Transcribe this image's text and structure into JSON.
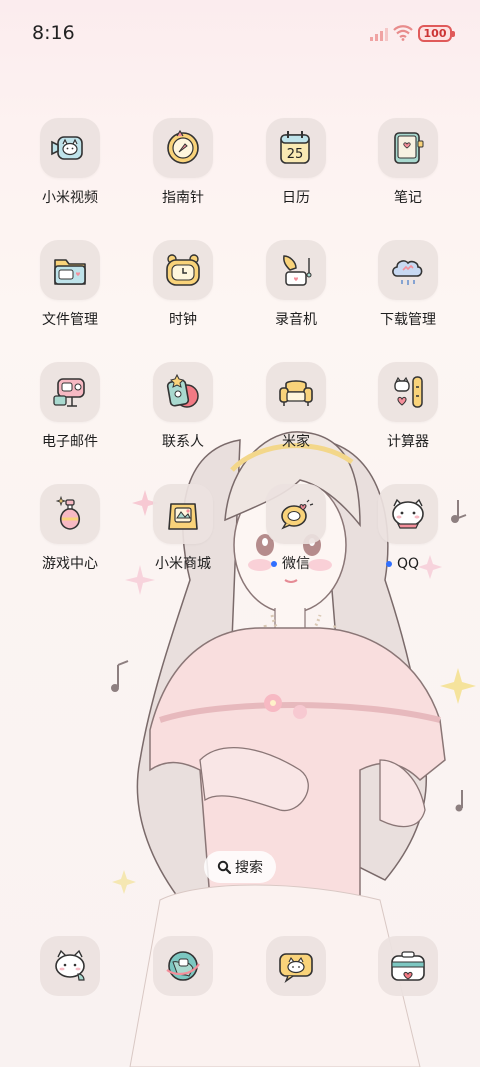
{
  "status_bar": {
    "time": "8:16",
    "battery": "100"
  },
  "apps": [
    {
      "label": "小米视频",
      "icon": "video-camera-cat-icon"
    },
    {
      "label": "指南针",
      "icon": "compass-icon"
    },
    {
      "label": "日历",
      "icon": "calendar-icon",
      "day": "25"
    },
    {
      "label": "笔记",
      "icon": "notebook-icon"
    },
    {
      "label": "文件管理",
      "icon": "folder-icon"
    },
    {
      "label": "时钟",
      "icon": "clock-icon"
    },
    {
      "label": "录音机",
      "icon": "gramophone-icon"
    },
    {
      "label": "下载管理",
      "icon": "cloud-download-icon"
    },
    {
      "label": "电子邮件",
      "icon": "mail-robot-icon"
    },
    {
      "label": "联系人",
      "icon": "contacts-icon"
    },
    {
      "label": "米家",
      "icon": "sofa-icon"
    },
    {
      "label": "计算器",
      "icon": "calculator-icon"
    },
    {
      "label": "游戏中心",
      "icon": "potion-bottle-icon"
    },
    {
      "label": "小米商城",
      "icon": "shopping-bag-icon"
    },
    {
      "label": "微信",
      "icon": "wechat-bubble-icon",
      "new": true
    },
    {
      "label": "QQ",
      "icon": "qq-cat-icon",
      "new": true
    }
  ],
  "search": {
    "label": "搜索"
  },
  "dock": [
    {
      "icon": "phone-cat-icon"
    },
    {
      "icon": "browser-globe-icon"
    },
    {
      "icon": "message-cat-icon"
    },
    {
      "icon": "camera-icon"
    }
  ],
  "colors": {
    "accent_dot": "#2f6fff",
    "icon_bg": "#ece2e0"
  }
}
